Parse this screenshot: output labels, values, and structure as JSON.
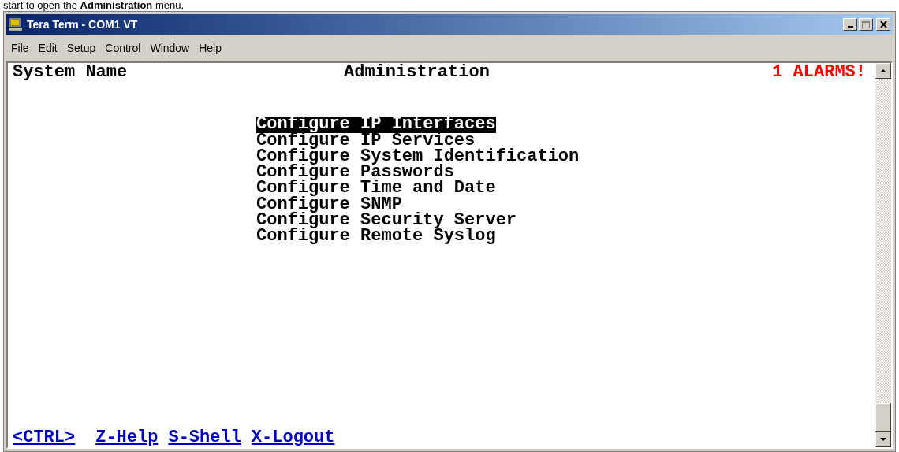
{
  "caption": "start to open the **Administration** menu.",
  "window": {
    "title": "Tera Term - COM1 VT"
  },
  "menu": [
    {
      "label": "File"
    },
    {
      "label": "Edit"
    },
    {
      "label": "Setup"
    },
    {
      "label": "Control"
    },
    {
      "label": "Window"
    },
    {
      "label": "Help"
    }
  ],
  "terminal": {
    "system_name": "System Name",
    "screen_title": "Administration",
    "alarm": "1 ALARMS!",
    "items": [
      {
        "label": "Configure IP Interfaces",
        "selected": true
      },
      {
        "label": "Configure IP Services",
        "selected": false
      },
      {
        "label": "Configure System Identification",
        "selected": false
      },
      {
        "label": "Configure Passwords",
        "selected": false
      },
      {
        "label": "Configure Time and Date",
        "selected": false
      },
      {
        "label": "Configure SNMP",
        "selected": false
      },
      {
        "label": "Configure Security Server",
        "selected": false
      },
      {
        "label": "Configure Remote Syslog",
        "selected": false
      }
    ],
    "footer": [
      "<CTRL>",
      "Z-Help",
      "S-Shell",
      "X-Logout"
    ]
  }
}
